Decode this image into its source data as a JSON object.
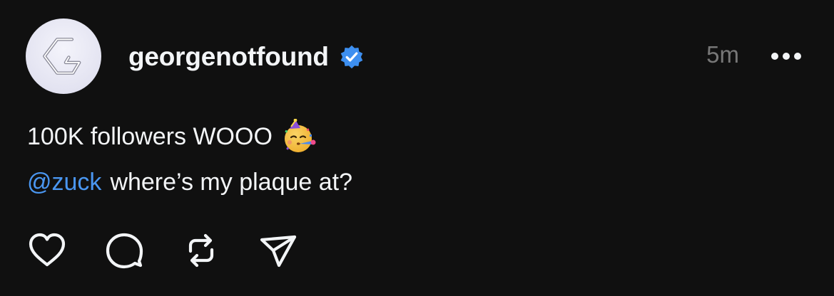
{
  "post": {
    "username": "georgenotfound",
    "verified": true,
    "timestamp": "5m",
    "text_line1": "100K followers WOOO",
    "emoji": "partying-face",
    "mention": "@zuck",
    "text_line2": "where’s my plaque at?"
  },
  "icons": {
    "avatar": "stylized-g-logo",
    "verified": "verified-badge-icon",
    "more": "more-options-icon",
    "like": "heart-icon",
    "reply": "comment-icon",
    "repost": "repost-icon",
    "share": "send-icon"
  },
  "colors": {
    "background": "#101010",
    "text": "#f3f5f7",
    "muted": "#777777",
    "mention": "#4a96f0",
    "verified": "#3d8ff0"
  }
}
